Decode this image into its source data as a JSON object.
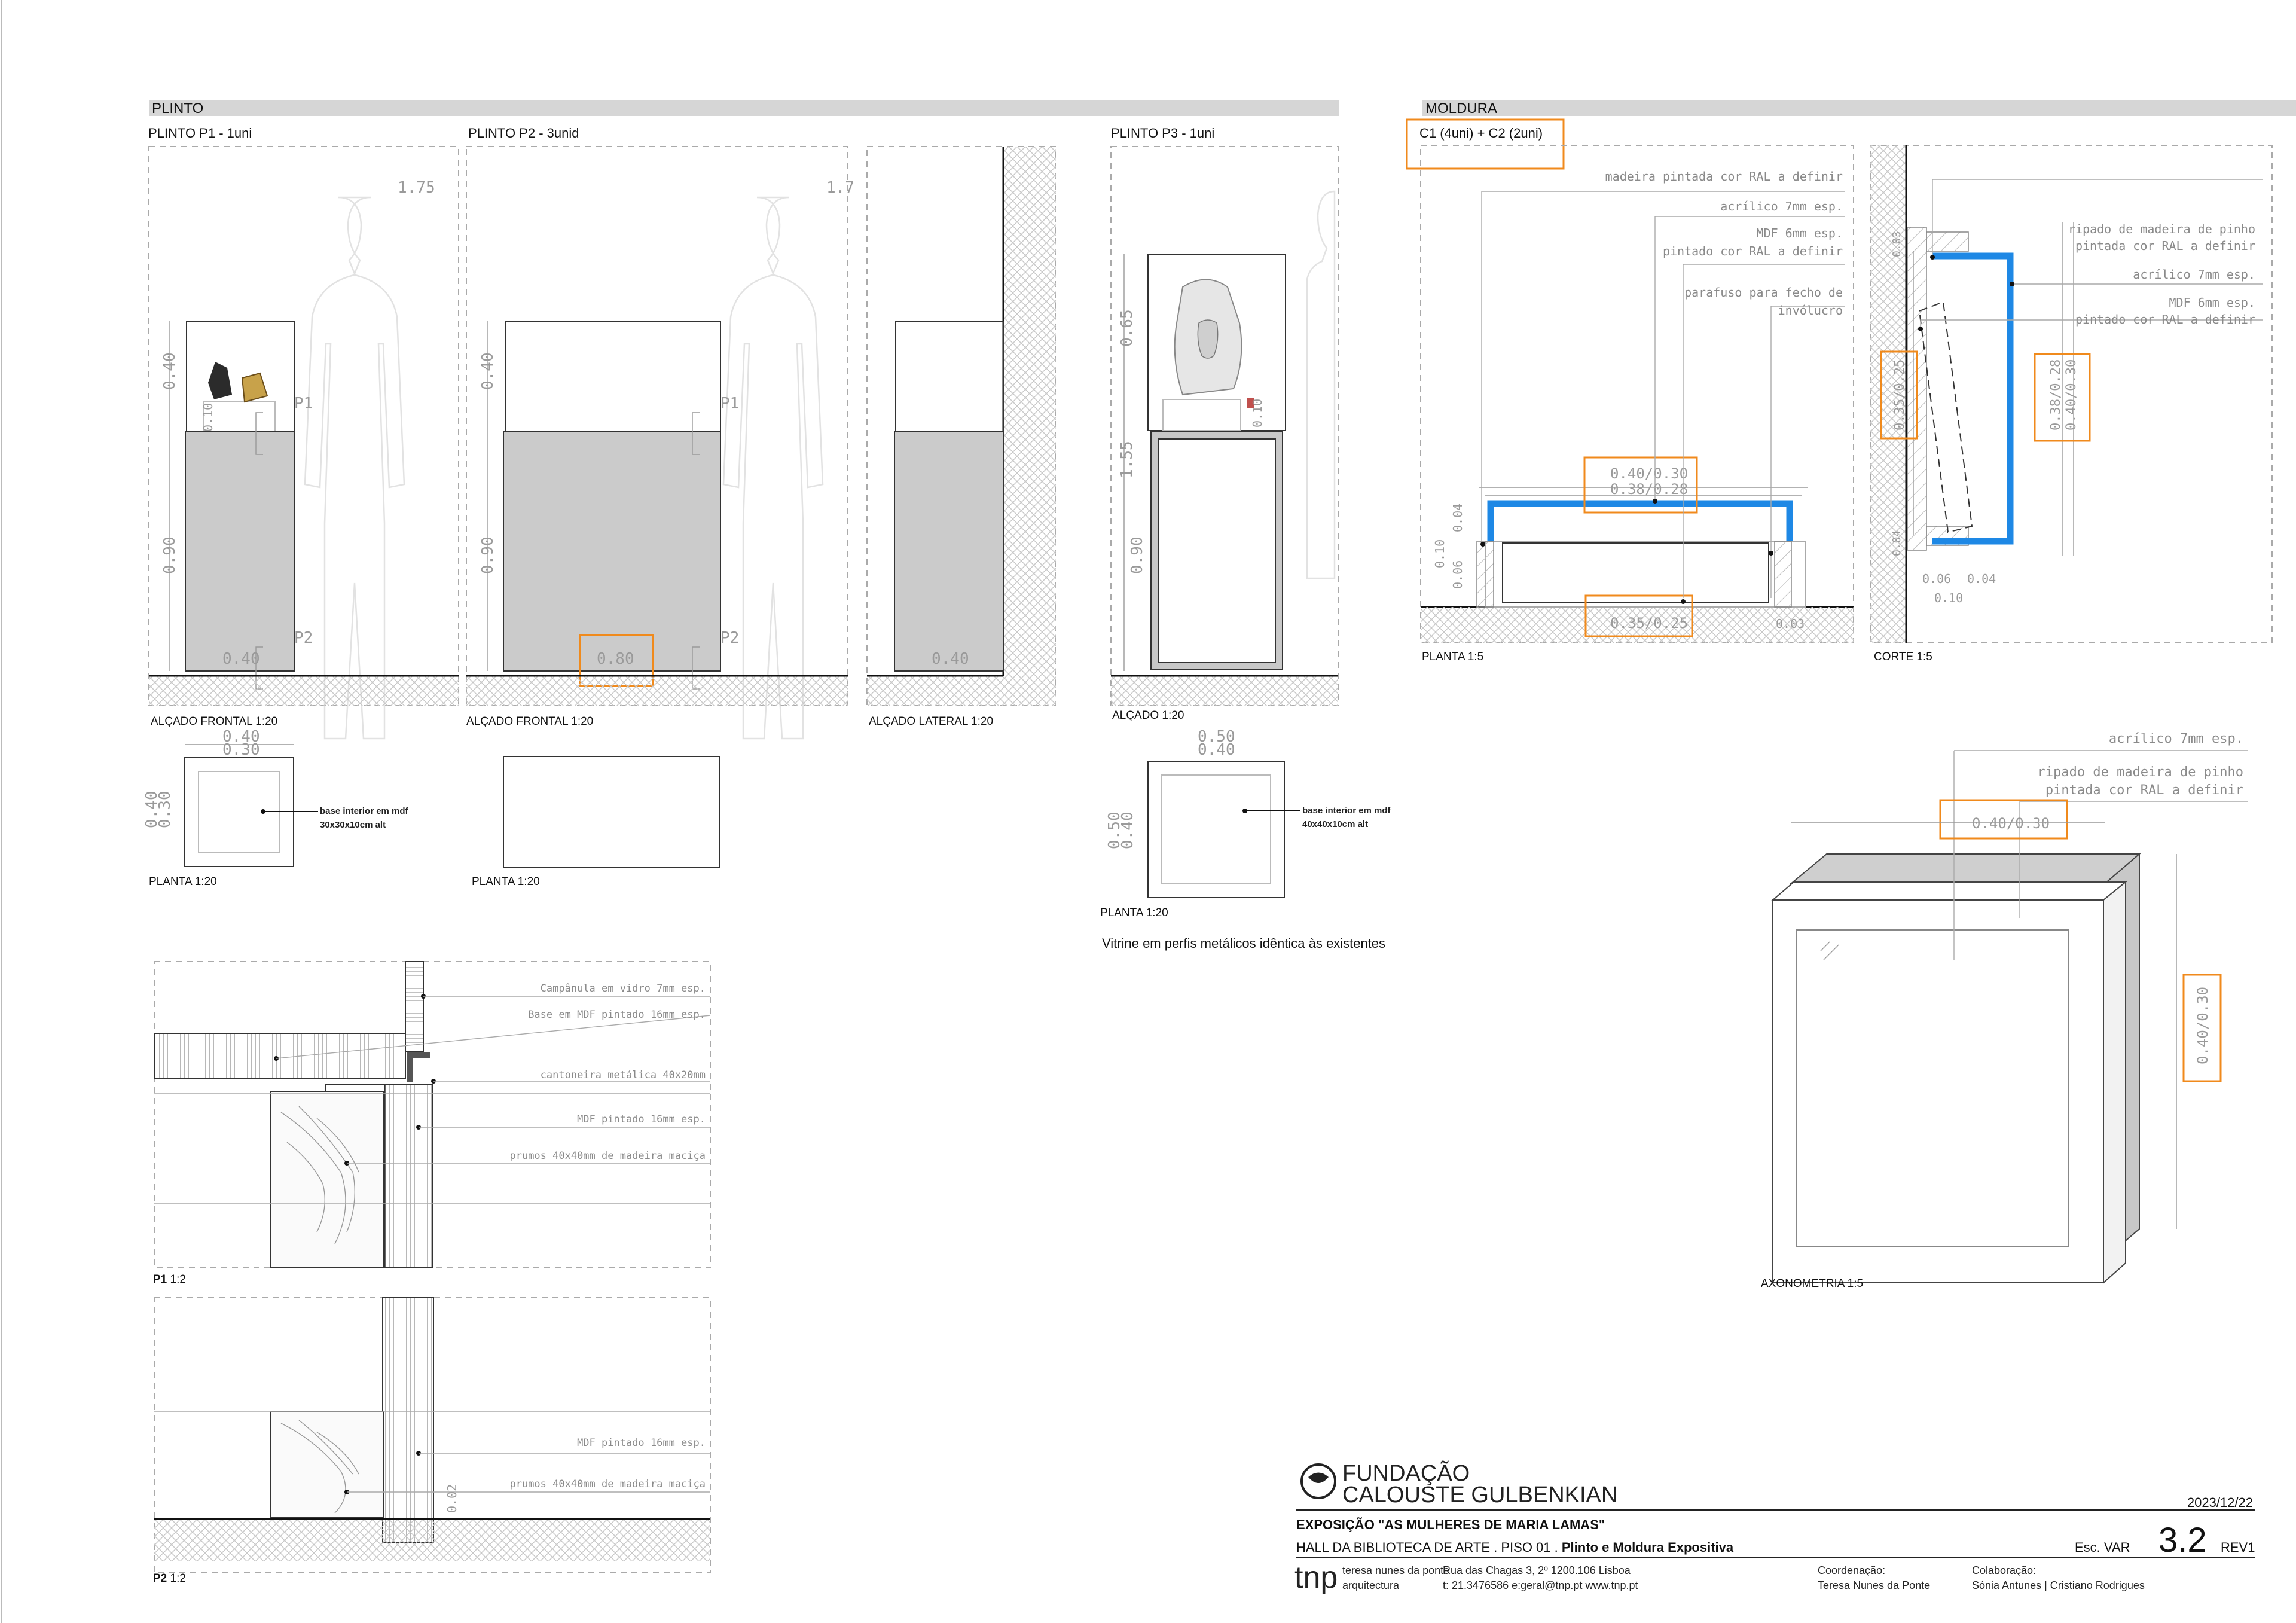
{
  "plinto": {
    "section_title": "PLINTO",
    "p1_title": "PLINTO P1 - 1uni",
    "p2_title": "PLINTO P2 - 3unid",
    "p3_title": "PLINTO P3 - 1uni",
    "p1_elev_label": "ALÇADO FRONTAL 1:20",
    "p2_elev_label": "ALÇADO FRONTAL 1:20",
    "lateral_label": "ALÇADO LATERAL 1:20",
    "p3_elev_label": "ALÇADO 1:20",
    "p1_plan_label": "PLANTA 1:20",
    "p2_plan_label": "PLANTA 1:20",
    "p3_plan_label": "PLANTA 1:20",
    "p1_dims": {
      "height_person": "1.75",
      "vitrine_h": "0.40",
      "base_h": "0.90",
      "base_w": "0.40",
      "p1_tag": "P1",
      "p2_tag": "P2",
      "mid": "0.10"
    },
    "p2_dims": {
      "height_person": "1.7",
      "vitrine_h": "0.40",
      "base_h": "0.90",
      "base_w": "0.80",
      "p1_tag": "P1",
      "p2_tag": "P2"
    },
    "lateral_dims": {
      "base_w": "0.40"
    },
    "p3_dims": {
      "top_h": "0.65",
      "total_h": "1.55",
      "base_h": "0.90",
      "mid": "0.10"
    },
    "p1_plan": {
      "w1": "0.40",
      "w2": "0.30",
      "h1": "0.40",
      "h2": "0.30",
      "note1": "base interior em mdf",
      "note2": "30x30x10cm alt"
    },
    "p3_plan": {
      "w1": "0.50",
      "w2": "0.40",
      "h1": "0.50",
      "h2": "0.40",
      "note1": "base interior em mdf",
      "note2": "40x40x10cm alt"
    },
    "p3_note": "Vitrine em perfis metálicos idêntica às existentes"
  },
  "details": {
    "p1_label": "P1",
    "p1_scale": "1:2",
    "p2_label": "P2",
    "p2_scale": "1:2",
    "p1_notes": [
      "Campânula em vidro 7mm esp.",
      "Base em MDF pintado 16mm esp.",
      "cantoneira metálica 40x20mm",
      "MDF pintado 16mm esp.",
      "prumos 40x40mm de madeira maciça"
    ],
    "p2_notes": [
      "MDF pintado 16mm esp.",
      "prumos 40x40mm de madeira maciça"
    ],
    "p2_dim": "0.02"
  },
  "moldura": {
    "section_title": "MOLDURA",
    "subtitle": "C1 (4uni) + C2 (2uni)",
    "planta_label": "PLANTA 1:5",
    "corte_label": "CORTE 1:5",
    "axon_label": "AXONOMETRIA 1:5",
    "planta_notes": [
      "madeira pintada cor RAL a definir",
      "acrílico 7mm esp.",
      "MDF 6mm esp.",
      "pintado cor RAL a definir",
      "parafuso para fecho de",
      "invólucro"
    ],
    "planta_dims": {
      "outer": "0.40/0.30",
      "inner": "0.38/0.28",
      "bottom": "0.35/0.25",
      "side_a": "0.04",
      "side_b": "0.10",
      "side_c": "0.06",
      "side_d": "0.03"
    },
    "corte_notes": [
      "ripado de madeira de pinho",
      "pintada cor RAL a definir",
      "acrílico 7mm esp.",
      "MDF 6mm esp.",
      "pintado cor RAL a definir"
    ],
    "corte_dims": {
      "h1": "0.38/0.28",
      "h2": "0.40/0.30",
      "left": "0.35/0.25",
      "b1": "0.06",
      "b2": "0.04",
      "b3": "0.10",
      "s1": "0.03",
      "s2": "0.04"
    },
    "axon_notes": [
      "acrílico 7mm esp.",
      "ripado de madeira de pinho",
      "pintada cor RAL a definir"
    ],
    "axon_dims": {
      "w": "0.40/0.30",
      "h": "0.40/0.30"
    }
  },
  "title_block": {
    "logo_line1": "FUNDAÇÃO",
    "logo_line2": "CALOUSTE GULBENKIAN",
    "date": "2023/12/22",
    "project": "EXPOSIÇÃO \"AS MULHERES DE MARIA LAMAS\"",
    "subtitle_pre": "HALL DA BIBLIOTECA DE ARTE . PISO 01 . ",
    "subtitle_bold": "Plinto e Moldura Expositiva",
    "scale": "Esc. VAR",
    "sheet": "3.2",
    "rev": "REV1",
    "tnp_logo": "tnp",
    "tnp_line1": "teresa nunes da ponte",
    "tnp_line2": "arquitectura",
    "address1": "Rua das Chagas 3, 2º 1200.106 Lisboa",
    "address2": "t: 21.3476586 e:geral@tnp.pt  www.tnp.pt",
    "coord_label": "Coordenação:",
    "coord_name": "Teresa Nunes da Ponte",
    "colab_label": "Colaboração:",
    "colab_names": "Sónia Antunes | Cristiano Rodrigues"
  }
}
